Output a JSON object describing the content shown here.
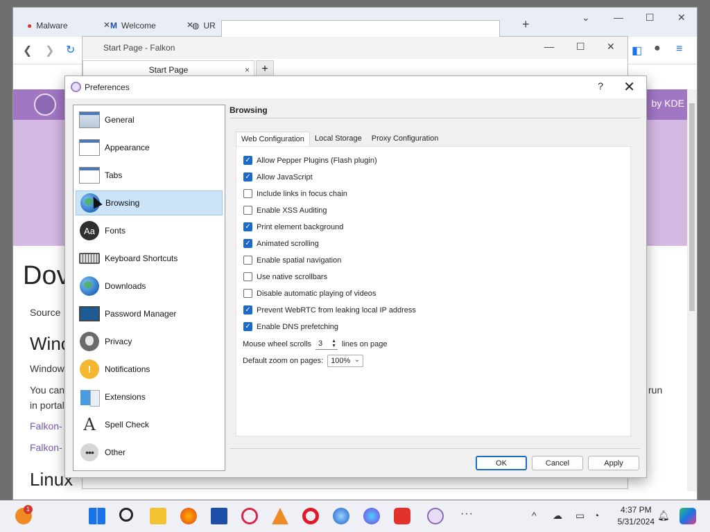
{
  "chrome": {
    "tabs": [
      "Malware",
      "Welcome",
      "UR"
    ],
    "new_tab": "+",
    "page": {
      "kde_text": "by KDE",
      "heading_download": "Dov",
      "source": "Source",
      "win_heading": "Winc",
      "windows": "Window",
      "you_can": "You can",
      "portal": "in portal",
      "run": "run",
      "link1": "Falkon-",
      "link2": "Falkon-",
      "linux": "Linux"
    }
  },
  "falkon": {
    "window_title": "Start Page - Falkon",
    "tab_label": "Start Page",
    "tab_close": "×",
    "new_tab": "+"
  },
  "prefs": {
    "title": "Preferences",
    "help": "?",
    "close": "✕",
    "sidebar": [
      {
        "label": "General",
        "icon": "general-icon"
      },
      {
        "label": "Appearance",
        "icon": "appearance-icon"
      },
      {
        "label": "Tabs",
        "icon": "tabs-icon"
      },
      {
        "label": "Browsing",
        "icon": "globe-icon"
      },
      {
        "label": "Fonts",
        "icon": "fonts-icon"
      },
      {
        "label": "Keyboard Shortcuts",
        "icon": "keyboard-icon"
      },
      {
        "label": "Downloads",
        "icon": "downloads-icon"
      },
      {
        "label": "Password Manager",
        "icon": "monitor-icon"
      },
      {
        "label": "Privacy",
        "icon": "privacy-mask-icon"
      },
      {
        "label": "Notifications",
        "icon": "notification-icon"
      },
      {
        "label": "Extensions",
        "icon": "extensions-icon"
      },
      {
        "label": "Spell Check",
        "icon": "spellcheck-icon"
      },
      {
        "label": "Other",
        "icon": "more-icon"
      }
    ],
    "active_section": "Browsing",
    "section_title": "Browsing",
    "tabs": [
      "Web Configuration",
      "Local Storage",
      "Proxy Configuration"
    ],
    "options": [
      {
        "label": "Allow Pepper Plugins (Flash plugin)",
        "checked": true
      },
      {
        "label": "Allow JavaScript",
        "checked": true
      },
      {
        "label": "Include links in focus chain",
        "checked": false
      },
      {
        "label": "Enable XSS Auditing",
        "checked": false
      },
      {
        "label": "Print element background",
        "checked": true
      },
      {
        "label": "Animated scrolling",
        "checked": true
      },
      {
        "label": "Enable spatial navigation",
        "checked": false
      },
      {
        "label": "Use native scrollbars",
        "checked": false
      },
      {
        "label": "Disable automatic playing of videos",
        "checked": false
      },
      {
        "label": "Prevent WebRTC from leaking local IP address",
        "checked": true
      },
      {
        "label": "Enable DNS prefetching",
        "checked": true
      }
    ],
    "wheel": {
      "prefix": "Mouse wheel scrolls",
      "value": "3",
      "suffix": "lines on page"
    },
    "zoom": {
      "label": "Default zoom on pages:",
      "value": "100%"
    },
    "buttons": {
      "ok": "OK",
      "cancel": "Cancel",
      "apply": "Apply"
    },
    "accent": "#1b6ac9"
  },
  "taskbar": {
    "time": "4:37 PM",
    "date": "5/31/2024",
    "badge": "1",
    "overflow": "···",
    "tray_chevron": "^"
  }
}
